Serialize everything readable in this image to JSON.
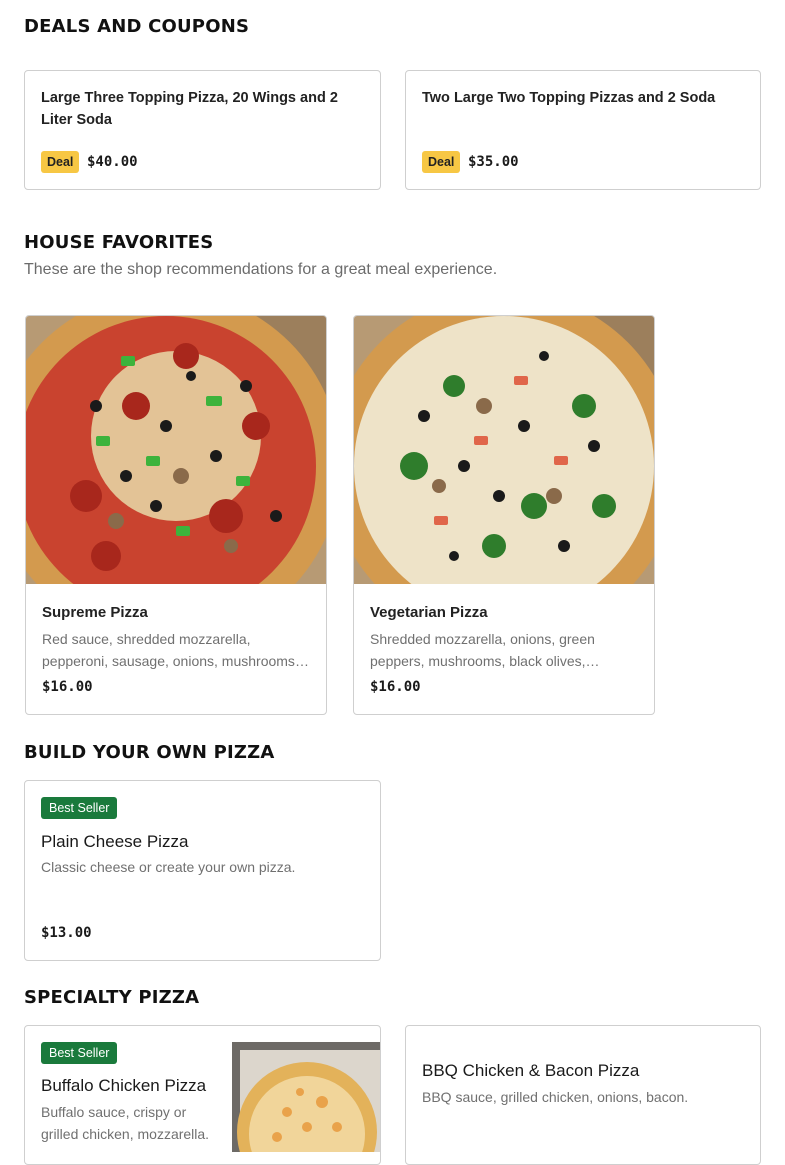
{
  "deals": {
    "title": "DEALS AND COUPONS",
    "items": [
      {
        "name": "Large Three Topping Pizza, 20 Wings and 2 Liter Soda",
        "badge": "Deal",
        "price": "$40.00"
      },
      {
        "name": "Two Large Two Topping Pizzas and 2 Soda",
        "badge": "Deal",
        "price": "$35.00"
      }
    ]
  },
  "favorites": {
    "title": "HOUSE FAVORITES",
    "subtitle": "These are the shop recommendations for a great meal experience.",
    "items": [
      {
        "name": "Supreme Pizza",
        "desc": "Red sauce, shredded mozzarella, pepperoni, sausage, onions, mushrooms, green peppers, black olives.",
        "price": "$16.00"
      },
      {
        "name": "Vegetarian Pizza",
        "desc": "Shredded mozzarella, onions, green peppers, mushrooms, black olives, tomatoes, broccoli.",
        "price": "$16.00"
      }
    ]
  },
  "byo": {
    "title": "BUILD YOUR OWN PIZZA",
    "items": [
      {
        "badge": "Best Seller",
        "name": "Plain Cheese Pizza",
        "desc": "Classic cheese or create your own pizza.",
        "price": "$13.00"
      }
    ]
  },
  "specialty": {
    "title": "SPECIALTY PIZZA",
    "items": [
      {
        "badge": "Best Seller",
        "name": "Buffalo Chicken Pizza",
        "desc": "Buffalo sauce, crispy or grilled chicken, mozzarella."
      },
      {
        "name": "BBQ Chicken & Bacon Pizza",
        "desc": "BBQ sauce, grilled chicken, onions, bacon."
      }
    ]
  },
  "colors": {
    "deal_badge": "#f7c744",
    "best_seller": "#1a7a3c",
    "border": "#cfcfcf"
  }
}
